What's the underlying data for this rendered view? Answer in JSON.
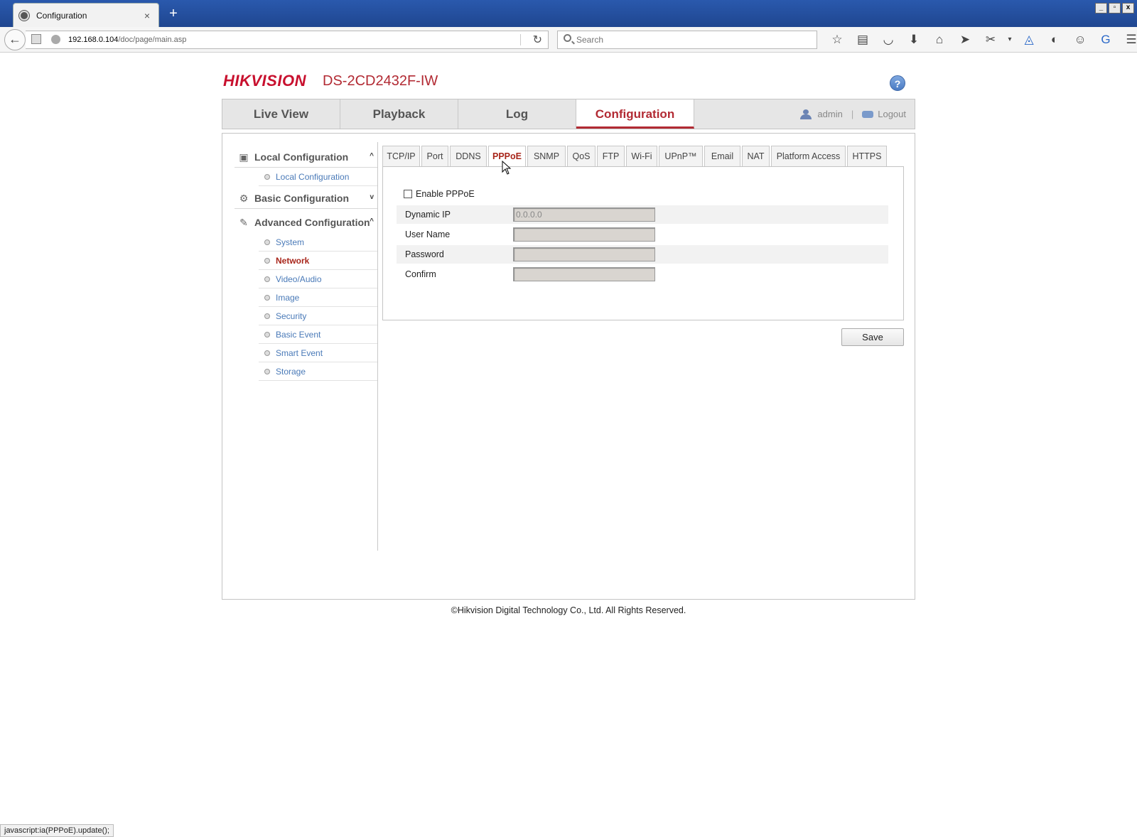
{
  "browser": {
    "tab_title": "Configuration",
    "tab_close": "×",
    "new_tab": "+",
    "window_controls": [
      "_",
      "▫",
      "x"
    ],
    "url_host": "192.168.0.104",
    "url_path": "/doc/page/main.asp",
    "search_placeholder": "Search",
    "toolbar_icons": [
      "star-icon",
      "reading-list-icon",
      "pocket-icon",
      "download-icon",
      "home-icon",
      "send-icon",
      "extension-icon",
      "dropdown-icon",
      "sync-icon",
      "history-icon",
      "chat-icon",
      "addon-icon",
      "menu-icon"
    ],
    "status_text": "javascript:ia(PPPoE).update();"
  },
  "header": {
    "logo": "HIKVISION",
    "model": "DS-2CD2432F-IW",
    "help": "?"
  },
  "main_tabs": [
    {
      "label": "Live View",
      "active": false
    },
    {
      "label": "Playback",
      "active": false
    },
    {
      "label": "Log",
      "active": false
    },
    {
      "label": "Configuration",
      "active": true
    }
  ],
  "user": {
    "name": "admin",
    "separator": "|",
    "logout": "Logout"
  },
  "sidebar": {
    "sections": [
      {
        "label": "Local Configuration",
        "expanded": true,
        "chevron": "^"
      },
      {
        "label": "Basic Configuration",
        "expanded": false,
        "chevron": "v"
      },
      {
        "label": "Advanced Configuration",
        "expanded": true,
        "chevron": "^"
      }
    ],
    "local_items": [
      "Local Configuration"
    ],
    "advanced_items": [
      "System",
      "Network",
      "Video/Audio",
      "Image",
      "Security",
      "Basic Event",
      "Smart Event",
      "Storage"
    ],
    "active_item": "Network"
  },
  "sub_tabs": [
    "TCP/IP",
    "Port",
    "DDNS",
    "PPPoE",
    "SNMP",
    "QoS",
    "FTP",
    "Wi-Fi",
    "UPnP™",
    "Email",
    "NAT",
    "Platform Access",
    "HTTPS"
  ],
  "active_sub_tab": "PPPoE",
  "pppoe": {
    "enable_label": "Enable PPPoE",
    "enabled": false,
    "fields": [
      {
        "label": "Dynamic IP",
        "value": "0.0.0.0"
      },
      {
        "label": "User Name",
        "value": ""
      },
      {
        "label": "Password",
        "value": ""
      },
      {
        "label": "Confirm",
        "value": ""
      }
    ]
  },
  "save_label": "Save",
  "footer": "©Hikvision Digital Technology Co., Ltd. All Rights Reserved."
}
